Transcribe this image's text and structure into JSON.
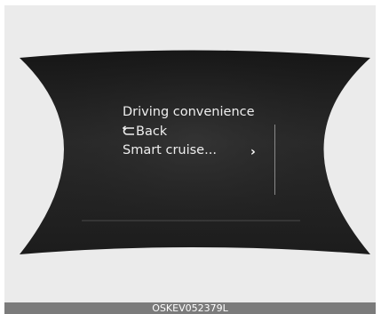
{
  "menu": {
    "title": "Driving convenience",
    "back_label": "Back",
    "item_label": "Smart cruise...",
    "chevron": "›"
  },
  "caption": "OSKEV052379L",
  "icons": {
    "back": "back-arrow-icon",
    "submenu": "chevron-right-icon"
  },
  "colors": {
    "screen": "#1e1e1e",
    "text": "#eeeeee",
    "frame": "#ebebeb",
    "caption_bar": "#7b7b7b"
  }
}
